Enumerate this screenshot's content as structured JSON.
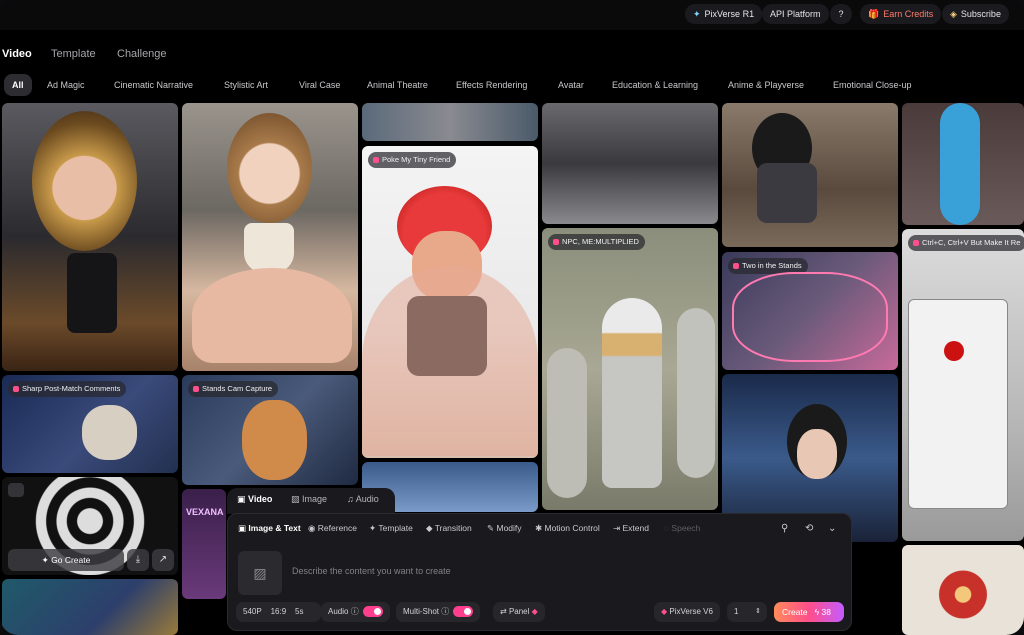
{
  "header": {
    "model_badge": "PixVerse R1",
    "api_platform": "API Platform",
    "earn_credits": "Earn Credits",
    "subscribe": "Subscribe"
  },
  "nav": {
    "tabs": [
      {
        "label": "Video",
        "active": true
      },
      {
        "label": "Template",
        "active": false
      },
      {
        "label": "Challenge",
        "active": false
      }
    ]
  },
  "categories": [
    {
      "label": "All",
      "active": true
    },
    {
      "label": "Ad Magic"
    },
    {
      "label": "Cinematic Narrative"
    },
    {
      "label": "Stylistic Art"
    },
    {
      "label": "Viral Case"
    },
    {
      "label": "Animal Theatre"
    },
    {
      "label": "Effects Rendering"
    },
    {
      "label": "Avatar"
    },
    {
      "label": "Education & Learning"
    },
    {
      "label": "Anime & Playverse"
    },
    {
      "label": "Emotional Close-up"
    }
  ],
  "gallery": {
    "labels": {
      "poke": "Poke My Tiny Friend",
      "npc": "NPC, ME:MULTIPLIED",
      "stands": "Two in the Stands",
      "ctrl": "Ctrl+C, Ctrl+V But Make It Re",
      "sharp": "Sharp Post-Match Comments",
      "cam": "Stands Cam Capture",
      "vexana": "VEXANA"
    },
    "go_create": "Go Create"
  },
  "composer": {
    "mode_tabs": [
      {
        "label": "Video",
        "active": true
      },
      {
        "label": "Image"
      },
      {
        "label": "Audio"
      }
    ],
    "tools": [
      {
        "label": "Image & Text",
        "active": true
      },
      {
        "label": "Reference"
      },
      {
        "label": "Template"
      },
      {
        "label": "Transition"
      },
      {
        "label": "Modify"
      },
      {
        "label": "Motion Control"
      },
      {
        "label": "Extend"
      },
      {
        "label": "Speech",
        "disabled": true
      }
    ],
    "prompt_placeholder": "Describe the content you want to create",
    "resolution": "540P",
    "aspect": "16:9",
    "duration": "5s",
    "audio_label": "Audio",
    "multishot_label": "Multi-Shot",
    "panel_label": "Panel",
    "model": "PixVerse V6",
    "count": "1",
    "create_label": "Create",
    "credits": "38"
  },
  "colors": {
    "accent": "#ff4f8b",
    "toggle": "#ff3f8e",
    "bg": "#000000",
    "panel": "#1a1a1e"
  }
}
